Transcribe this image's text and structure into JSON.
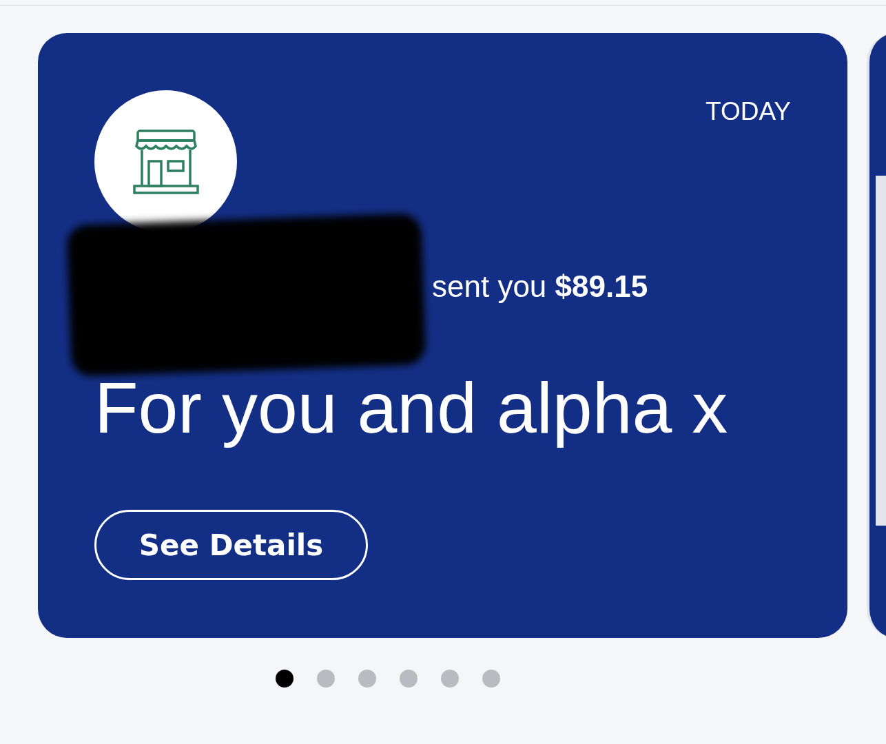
{
  "card": {
    "date": "TODAY",
    "message": "sent you **$89.15**",
    "note": "For you and alpha x",
    "button": "See Details"
  },
  "carousel_dots": [
    {
      "selected": true
    },
    {
      "selected": false
    },
    {
      "selected": false
    },
    {
      "selected": false
    },
    {
      "selected": false
    },
    {
      "selected": false
    }
  ]
}
